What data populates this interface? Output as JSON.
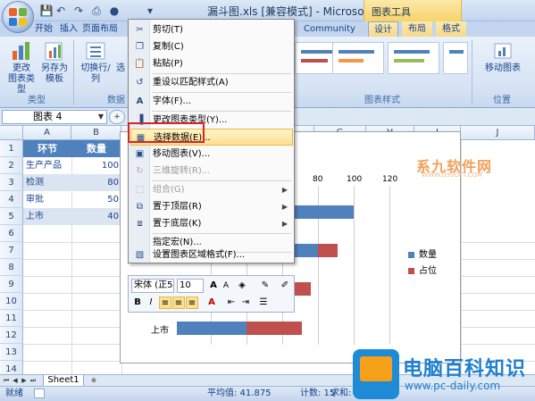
{
  "window": {
    "title": "漏斗图.xls  [兼容模式] - Microsoft Excel",
    "context_tab_group": "图表工具"
  },
  "tabs": [
    {
      "label": "开始"
    },
    {
      "label": "插入"
    },
    {
      "label": "页面布局"
    },
    {
      "label": "Community Clips"
    },
    {
      "label": "设计"
    },
    {
      "label": "布局"
    },
    {
      "label": "格式"
    }
  ],
  "ribbon": {
    "change_chart_type": "更改\n图表类型",
    "save_as_template": "另存为\n模板",
    "switch_row_col": "切换行/列",
    "select_data": "选",
    "group_type": "类型",
    "group_data": "数据",
    "group_chart_styles": "图表样式",
    "move_chart": "移动图表",
    "group_location": "位置"
  },
  "formula_bar": {
    "name_box": "图表 4",
    "fx": "+"
  },
  "columns": [
    "A",
    "B",
    "C",
    "D",
    "E",
    "F",
    "G",
    "H",
    "I",
    "J"
  ],
  "rows": [
    "1",
    "2",
    "3",
    "4",
    "5",
    "6",
    "7",
    "8",
    "9",
    "10",
    "11",
    "12",
    "13",
    "14",
    "15"
  ],
  "table": {
    "headers": [
      "环节",
      "数量"
    ],
    "rows": [
      {
        "name": "生产产品",
        "value": "100"
      },
      {
        "name": "检测",
        "value": "80"
      },
      {
        "name": "审批",
        "value": "50"
      },
      {
        "name": "上市",
        "value": "40"
      }
    ]
  },
  "chart_data": {
    "type": "bar",
    "axis_ticks": [
      "80",
      "100",
      "120"
    ],
    "categories": [
      "上市"
    ],
    "series": [
      {
        "name": "数量",
        "color": "#4f81bd"
      },
      {
        "name": "占位",
        "color": "#c0504d"
      }
    ],
    "legend_position": "right"
  },
  "context_menu": {
    "items": [
      {
        "label": "剪切(T)",
        "icon": "scissors-icon",
        "enabled": true
      },
      {
        "label": "复制(C)",
        "icon": "copy-icon",
        "enabled": true
      },
      {
        "label": "粘贴(P)",
        "icon": "paste-icon",
        "enabled": true
      },
      {
        "label": "重设以匹配样式(A)",
        "icon": "reset-style-icon",
        "enabled": true
      },
      {
        "label": "字体(F)...",
        "icon": "font-icon",
        "enabled": true
      },
      {
        "label": "更改图表类型(Y)...",
        "icon": "chart-type-icon",
        "enabled": true
      },
      {
        "label": "选择数据(E)...",
        "icon": "select-data-icon",
        "enabled": true,
        "highlighted": true
      },
      {
        "label": "移动图表(V)...",
        "icon": "move-chart-icon",
        "enabled": true
      },
      {
        "label": "三维旋转(R)...",
        "icon": "rotate-3d-icon",
        "enabled": false
      },
      {
        "label": "组合(G)",
        "icon": "group-icon",
        "enabled": false,
        "submenu": true
      },
      {
        "label": "置于顶层(R)",
        "icon": "bring-front-icon",
        "enabled": true,
        "submenu": true
      },
      {
        "label": "置于底层(K)",
        "icon": "send-back-icon",
        "enabled": true,
        "submenu": true
      },
      {
        "label": "指定宏(N)...",
        "icon": "macro-icon",
        "enabled": true
      },
      {
        "label": "设置图表区域格式(F)...",
        "icon": "format-chart-icon",
        "enabled": true
      }
    ]
  },
  "mini_toolbar": {
    "font": "宋体 (正5",
    "size": "10"
  },
  "sheet_tabs": {
    "active": "Sheet1"
  },
  "status_bar": {
    "mode": "就绪",
    "average": "平均值: 41.875",
    "count": "计数: 15",
    "sum": "求和: 335"
  },
  "watermarks": {
    "top": "系九软件网",
    "top_sub": "WWW.D9SOFT.COM",
    "logo_title": "电脑百科知识",
    "logo_url": "www.pc-daily.com"
  },
  "colors": {
    "accent": "#4f81bd",
    "accent_red": "#c0504d",
    "highlight_box": "#d0262a",
    "context_tab": "#f7d46a"
  }
}
